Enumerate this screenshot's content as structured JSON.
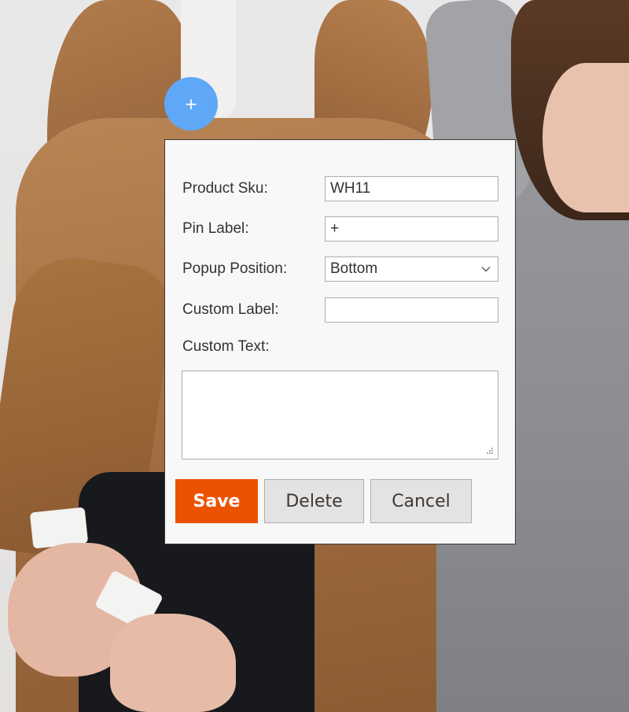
{
  "pin": {
    "label": "+"
  },
  "form": {
    "product_sku": {
      "label": "Product Sku:",
      "value": "WH11"
    },
    "pin_label": {
      "label": "Pin Label:",
      "value": "+"
    },
    "popup_position": {
      "label": "Popup Position:",
      "value": "Bottom"
    },
    "custom_label": {
      "label": "Custom Label:",
      "value": ""
    },
    "custom_text": {
      "label": "Custom Text:",
      "value": ""
    }
  },
  "buttons": {
    "save": "Save",
    "delete": "Delete",
    "cancel": "Cancel"
  },
  "colors": {
    "pin": "#5ea8f7",
    "save": "#eb5202",
    "secondary_button": "#e3e3e3"
  }
}
